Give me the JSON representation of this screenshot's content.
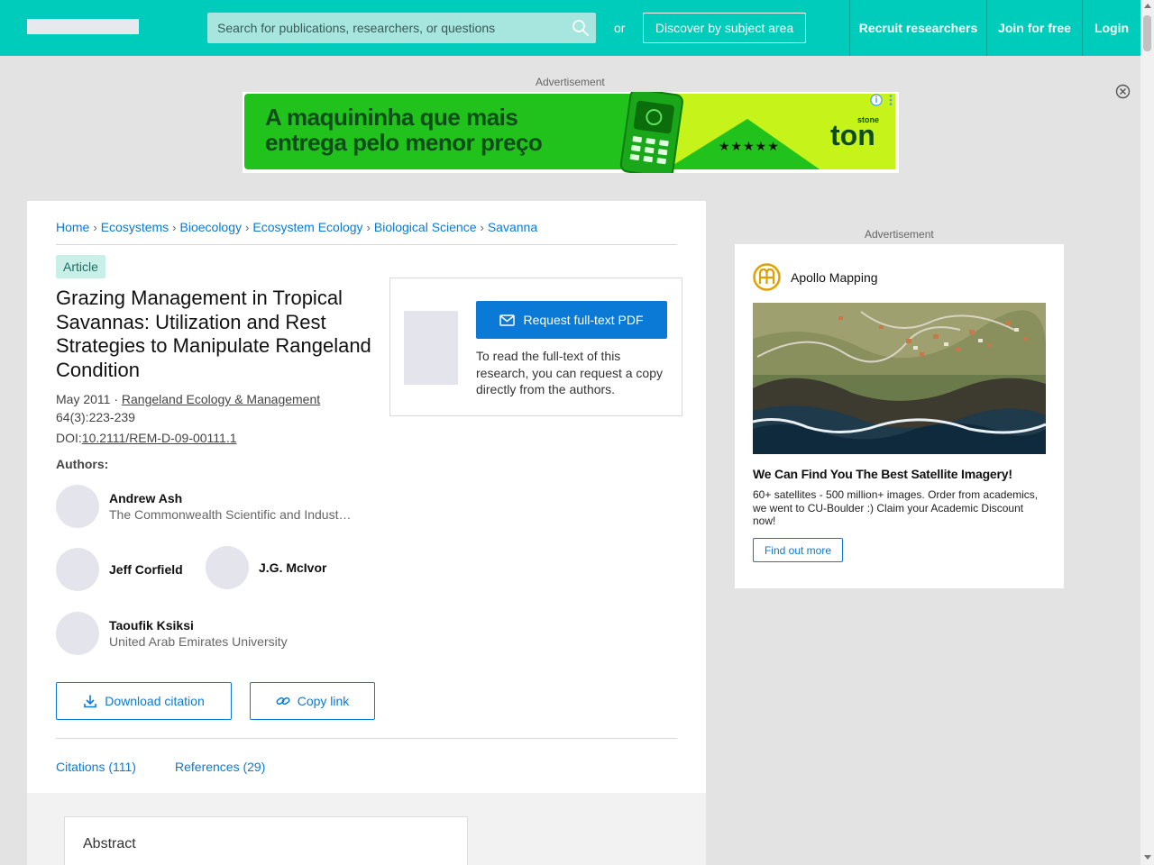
{
  "header": {
    "search_placeholder": "Search for publications, researchers, or questions",
    "or_text": "or",
    "discover_label": "Discover by subject area",
    "nav": [
      "Recruit researchers",
      "Join for free",
      "Login"
    ]
  },
  "top_ad": {
    "label": "Advertisement",
    "headline_line1": "A maquininha que mais",
    "headline_line2": "entrega pelo menor preço",
    "stars": "★★★★★",
    "brand": "ton",
    "brand_small": "stone"
  },
  "breadcrumb": [
    "Home",
    "Ecosystems",
    "Bioecology",
    "Ecosystem Ecology",
    "Biological Science",
    "Savanna"
  ],
  "article": {
    "badge": "Article",
    "title": "Grazing Management in Tropical Savannas: Utilization and Rest Strategies to Manipulate Rangeland Condition",
    "date": "May 2011 · ",
    "journal": "Rangeland Ecology & Management",
    "volume": "64(3):223-239",
    "doi_prefix": "DOI:",
    "doi": "10.2111/REM-D-09-00111.1",
    "authors_label": "Authors:",
    "authors": [
      {
        "name": "Andrew Ash",
        "affiliation": "The Commonwealth Scientific and Industrial Research Organisation"
      },
      {
        "name": "Jeff Corfield",
        "affiliation": ""
      },
      {
        "name": "J.G. McIvor",
        "affiliation": ""
      },
      {
        "name": "Taoufik Ksiksi",
        "affiliation": "United Arab Emirates University"
      }
    ],
    "download_citation": "Download citation",
    "copy_link": "Copy link",
    "tabs": [
      "Citations (111)",
      "References (29)"
    ],
    "abstract_title": "Abstract"
  },
  "fulltext": {
    "request_label": "Request full-text PDF",
    "description": "To read the full-text of this research, you can request a copy directly from the authors."
  },
  "side_ad": {
    "label": "Advertisement",
    "advertiser": "Apollo Mapping",
    "headline": "We Can Find You The Best Satellite Imagery!",
    "body": "60+ satellites - 500 million+ images. Order from academics, we went to CU-Boulder :) Claim your Academic Discount now!",
    "cta": "Find out more"
  },
  "colors": {
    "brand_teal": "#00ccbb",
    "link_blue": "#0a7ad6",
    "ad_green": "#22c21d",
    "ad_lime": "#c6f31a"
  }
}
